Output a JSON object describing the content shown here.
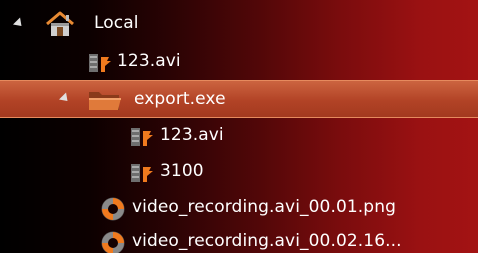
{
  "tree": {
    "root": {
      "label": "Local",
      "icon": "home-icon",
      "expanded": true
    },
    "items": [
      {
        "label": "123.avi",
        "icon": "film-file-icon"
      },
      {
        "label": "export.exe",
        "icon": "folder-icon",
        "expanded": true,
        "selected": true
      },
      {
        "label": "123.avi",
        "icon": "film-file-icon"
      },
      {
        "label": "3100",
        "icon": "film-file-icon"
      },
      {
        "label": "video_recording.avi_00.01.png",
        "icon": "aperture-icon"
      },
      {
        "label": "video_recording.avi_00.02.16...",
        "icon": "aperture-icon"
      }
    ]
  },
  "colors": {
    "selection": "#b24326",
    "selection_border": "#e68a5e",
    "accent_orange": "#f07a1e"
  }
}
